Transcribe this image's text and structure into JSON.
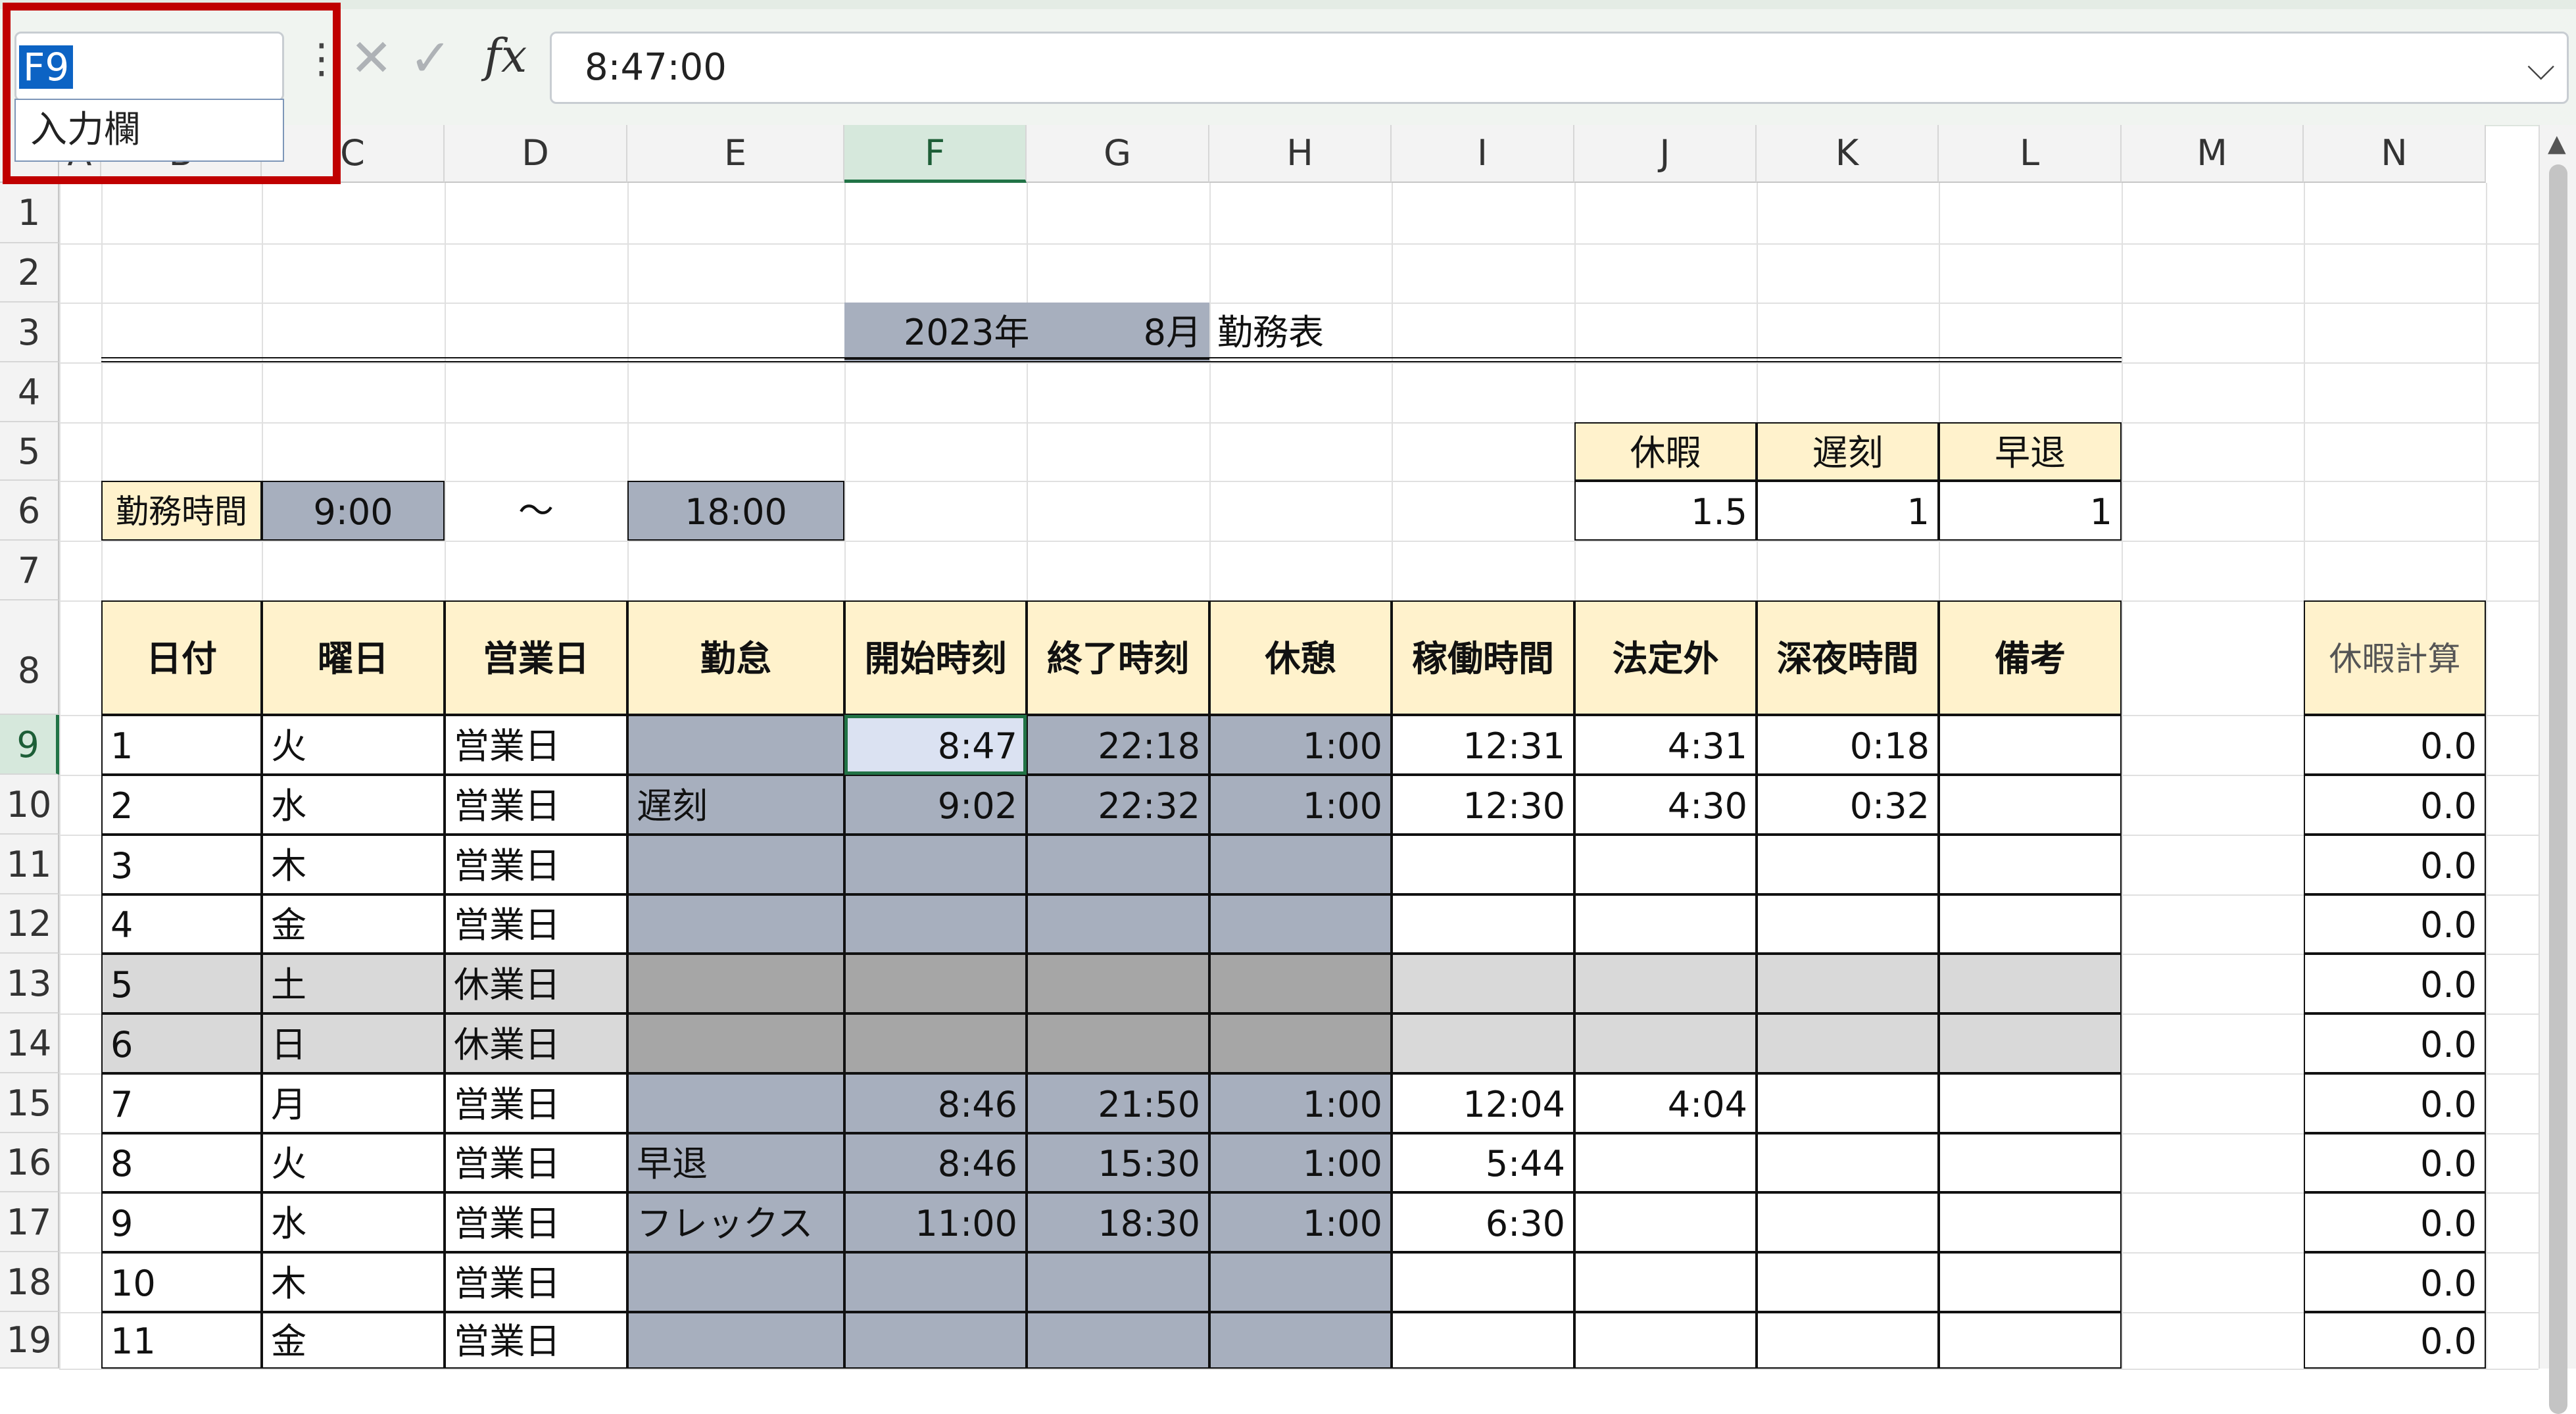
{
  "formula_bar": {
    "name_box_value": "F9",
    "name_dropdown_item": "入力欄",
    "more_icon": "⋮",
    "cancel_icon": "✕",
    "enter_icon": "✓",
    "fx_label": "fx",
    "formula_value": "8:47:00",
    "expand_icon": "⌵"
  },
  "columns": [
    "A",
    "B",
    "C",
    "D",
    "E",
    "F",
    "G",
    "H",
    "I",
    "J",
    "K",
    "L",
    "M",
    "N"
  ],
  "rows": [
    "1",
    "2",
    "3",
    "4",
    "5",
    "6",
    "7",
    "8",
    "9",
    "10",
    "11",
    "12",
    "13",
    "14",
    "15",
    "16",
    "17",
    "18",
    "19"
  ],
  "title": {
    "year": "2023年",
    "month": "8月",
    "label": "勤務表"
  },
  "work_hours": {
    "label": "勤務時間",
    "start": "9:00",
    "tilde": "～",
    "end": "18:00"
  },
  "counts": {
    "headers": [
      "休暇",
      "遅刻",
      "早退"
    ],
    "values": [
      "1.5",
      "1",
      "1"
    ]
  },
  "table": {
    "headers": [
      "日付",
      "曜日",
      "営業日",
      "勤怠",
      "開始時刻",
      "終了時刻",
      "休憩",
      "稼働時間",
      "法定外",
      "深夜時間",
      "備考"
    ],
    "rows": [
      [
        "1",
        "火",
        "営業日",
        "",
        "8:47",
        "22:18",
        "1:00",
        "12:31",
        "4:31",
        "0:18",
        ""
      ],
      [
        "2",
        "水",
        "営業日",
        "遅刻",
        "9:02",
        "22:32",
        "1:00",
        "12:30",
        "4:30",
        "0:32",
        ""
      ],
      [
        "3",
        "木",
        "営業日",
        "",
        "",
        "",
        "",
        "",
        "",
        "",
        ""
      ],
      [
        "4",
        "金",
        "営業日",
        "",
        "",
        "",
        "",
        "",
        "",
        "",
        ""
      ],
      [
        "5",
        "土",
        "休業日",
        "",
        "",
        "",
        "",
        "",
        "",
        "",
        ""
      ],
      [
        "6",
        "日",
        "休業日",
        "",
        "",
        "",
        "",
        "",
        "",
        "",
        ""
      ],
      [
        "7",
        "月",
        "営業日",
        "",
        "8:46",
        "21:50",
        "1:00",
        "12:04",
        "4:04",
        "",
        ""
      ],
      [
        "8",
        "火",
        "営業日",
        "早退",
        "8:46",
        "15:30",
        "1:00",
        "5:44",
        "",
        "",
        ""
      ],
      [
        "9",
        "水",
        "営業日",
        "フレックス",
        "11:00",
        "18:30",
        "1:00",
        "6:30",
        "",
        "",
        ""
      ],
      [
        "10",
        "木",
        "営業日",
        "",
        "",
        "",
        "",
        "",
        "",
        "",
        ""
      ],
      [
        "11",
        "金",
        "営業日",
        "",
        "",
        "",
        "",
        "",
        "",
        "",
        ""
      ]
    ]
  },
  "leave_calc": {
    "header": "休暇計算",
    "values": [
      "0.0",
      "0.0",
      "0.0",
      "0.0",
      "0.0",
      "0.0",
      "0.0",
      "0.0",
      "0.0",
      "0.0",
      "0.0"
    ]
  },
  "colors": {
    "header_fill": "#fff2cc",
    "input_fill": "#a7afbe",
    "holiday_input_fill": "#a6a6a6",
    "holiday_fill": "#d9d9d9",
    "selection": "#217346",
    "highlight_box": "#c00000"
  }
}
